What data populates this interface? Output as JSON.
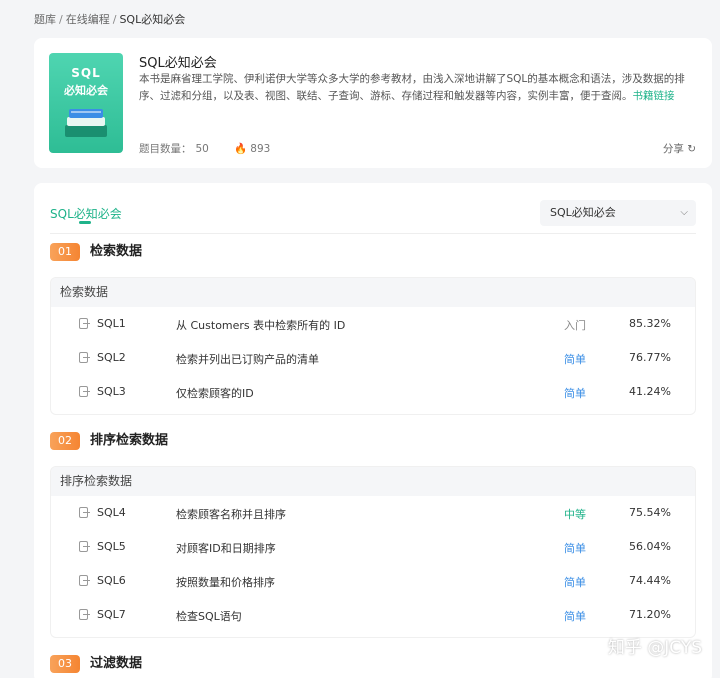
{
  "breadcrumb": [
    "题库",
    "在线编程",
    "SQL必知必会"
  ],
  "book": {
    "cover_line1": "SQL",
    "cover_line2": "必知必会",
    "title": "SQL必知必会",
    "description": "本书是麻省理工学院、伊利诺伊大学等众多大学的参考教材，由浅入深地讲解了SQL的基本概念和语法，涉及数据的排序、过滤和分组，以及表、视图、联结、子查询、游标、存储过程和触发器等内容，实例丰富，便于查阅。",
    "link_label": "书籍链接",
    "count_label": "题目数量：",
    "count": "50",
    "hot": "893",
    "share_label": "分享"
  },
  "tab": {
    "active": "SQL必知必会"
  },
  "select": {
    "value": "SQL必知必会"
  },
  "colors": {
    "accent": "#1fb38a",
    "entry": "#888888",
    "easy": "#3a8ee6",
    "medium": "#1fb38a"
  },
  "chapters": [
    {
      "num": "01",
      "title": "检索数据",
      "group": "检索数据",
      "rows": [
        {
          "code": "SQL1",
          "name": "从 Customers 表中检索所有的 ID",
          "level": "入门",
          "rate": "85.32%"
        },
        {
          "code": "SQL2",
          "name": "检索并列出已订购产品的清单",
          "level": "简单",
          "rate": "76.77%"
        },
        {
          "code": "SQL3",
          "name": "仅检索顾客的ID",
          "level": "简单",
          "rate": "41.24%"
        }
      ]
    },
    {
      "num": "02",
      "title": "排序检索数据",
      "group": "排序检索数据",
      "rows": [
        {
          "code": "SQL4",
          "name": "检索顾客名称并且排序",
          "level": "中等",
          "rate": "75.54%"
        },
        {
          "code": "SQL5",
          "name": "对顾客ID和日期排序",
          "level": "简单",
          "rate": "56.04%"
        },
        {
          "code": "SQL6",
          "name": "按照数量和价格排序",
          "level": "简单",
          "rate": "74.44%"
        },
        {
          "code": "SQL7",
          "name": "检查SQL语句",
          "level": "简单",
          "rate": "71.20%"
        }
      ]
    },
    {
      "num": "03",
      "title": "过滤数据"
    }
  ],
  "watermark": "知乎 @JCYS"
}
